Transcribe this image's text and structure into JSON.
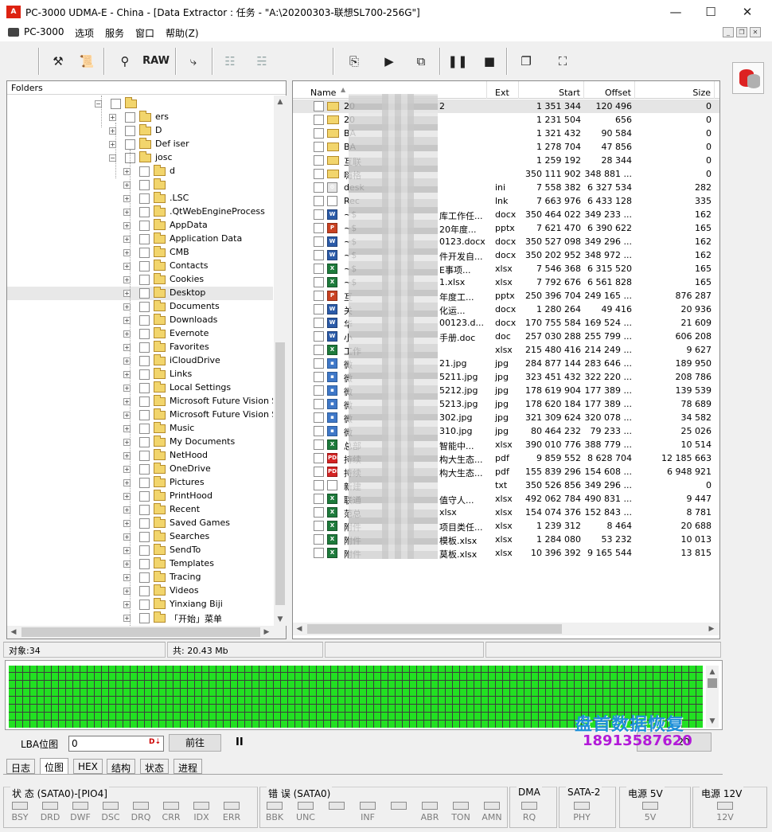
{
  "window": {
    "title": "PC-3000 UDMA-E - China - [Data Extractor : 任务 - \"A:\\20200303-联想SL700-256G\"]",
    "icon_text": "A",
    "minimize": "—",
    "maximize": "☐",
    "close": "✕"
  },
  "menu": [
    "PC-3000",
    "选项",
    "服务",
    "窗口",
    "帮助(Z)"
  ],
  "toolbar": {
    "raw_label": "RAW"
  },
  "folders_panel": {
    "header": "Folders",
    "items": [
      {
        "label": "",
        "level": 1,
        "expanded": true
      },
      {
        "label": "ers",
        "level": 2
      },
      {
        "label": "D",
        "level": 2
      },
      {
        "label": "Def  iser",
        "level": 2
      },
      {
        "label": "josc",
        "level": 2,
        "expanded": true
      },
      {
        "label": "d",
        "level": 3
      },
      {
        "label": "",
        "level": 3
      },
      {
        "label": ".LSC",
        "level": 3
      },
      {
        "label": ".QtWebEngineProcess",
        "level": 3
      },
      {
        "label": "AppData",
        "level": 3
      },
      {
        "label": "Application Data",
        "level": 3
      },
      {
        "label": "CMB",
        "level": 3
      },
      {
        "label": "Contacts",
        "level": 3
      },
      {
        "label": "Cookies",
        "level": 3
      },
      {
        "label": "Desktop",
        "level": 3,
        "selected": true
      },
      {
        "label": "Documents",
        "level": 3
      },
      {
        "label": "Downloads",
        "level": 3
      },
      {
        "label": "Evernote",
        "level": 3
      },
      {
        "label": "Favorites",
        "level": 3
      },
      {
        "label": "iCloudDrive",
        "level": 3
      },
      {
        "label": "Links",
        "level": 3
      },
      {
        "label": "Local Settings",
        "level": 3
      },
      {
        "label": "Microsoft  Future Vision Ser",
        "level": 3
      },
      {
        "label": "Microsoft  Future Vision Ser",
        "level": 3
      },
      {
        "label": "Music",
        "level": 3
      },
      {
        "label": "My Documents",
        "level": 3
      },
      {
        "label": "NetHood",
        "level": 3
      },
      {
        "label": "OneDrive",
        "level": 3
      },
      {
        "label": "Pictures",
        "level": 3
      },
      {
        "label": "PrintHood",
        "level": 3
      },
      {
        "label": "Recent",
        "level": 3
      },
      {
        "label": "Saved Games",
        "level": 3
      },
      {
        "label": "Searches",
        "level": 3
      },
      {
        "label": "SendTo",
        "level": 3
      },
      {
        "label": "Templates",
        "level": 3
      },
      {
        "label": "Tracing",
        "level": 3
      },
      {
        "label": "Videos",
        "level": 3
      },
      {
        "label": "Yinxiang Biji",
        "level": 3
      },
      {
        "label": "「开始」菜单",
        "level": 3
      }
    ]
  },
  "files_panel": {
    "columns": {
      "name": "Name",
      "ext": "Ext",
      "start": "Start",
      "offset": "Offset",
      "size": "Size"
    },
    "rows": [
      {
        "name": "20",
        "tail": "2",
        "ext": "",
        "start": "1 351 344",
        "offset": "120 496",
        "size": "0",
        "icon": "folder",
        "selected": true
      },
      {
        "name": "20",
        "tail": "",
        "ext": "",
        "start": "1 231 504",
        "offset": "656",
        "size": "0",
        "icon": "folder"
      },
      {
        "name": "BA",
        "tail": "",
        "ext": "",
        "start": "1 321 432",
        "offset": "90 584",
        "size": "0",
        "icon": "folder"
      },
      {
        "name": "BA",
        "tail": "",
        "ext": "",
        "start": "1 278 704",
        "offset": "47 856",
        "size": "0",
        "icon": "folder"
      },
      {
        "name": "互联",
        "tail": "",
        "ext": "",
        "start": "1 259 192",
        "offset": "28 344",
        "size": "0",
        "icon": "folder"
      },
      {
        "name": "嗨格",
        "tail": "",
        "ext": "",
        "start": "350 111 902",
        "offset": "348 881 ...",
        "size": "0",
        "icon": "folder"
      },
      {
        "name": "desk",
        "tail": "",
        "ext": "ini",
        "start": "7 558 382",
        "offset": "6 327 534",
        "size": "282",
        "icon": "ini"
      },
      {
        "name": "Rec",
        "tail": "",
        "ext": "lnk",
        "start": "7 663 976",
        "offset": "6 433 128",
        "size": "335",
        "icon": "lnk"
      },
      {
        "name": "~$",
        "tail": "库工作任...",
        "ext": "docx",
        "start": "350 464 022",
        "offset": "349 233 ...",
        "size": "162",
        "icon": "docx"
      },
      {
        "name": "~$",
        "tail": "20年度...",
        "ext": "pptx",
        "start": "7 621 470",
        "offset": "6 390 622",
        "size": "165",
        "icon": "pptx"
      },
      {
        "name": "~$",
        "tail": "0123.docx",
        "ext": "docx",
        "start": "350 527 098",
        "offset": "349 296 ...",
        "size": "162",
        "icon": "docx"
      },
      {
        "name": "~$",
        "tail": "件开发自...",
        "ext": "docx",
        "start": "350 202 952",
        "offset": "348 972 ...",
        "size": "162",
        "icon": "docx"
      },
      {
        "name": "~$",
        "tail": "E事项...",
        "ext": "xlsx",
        "start": "7 546 368",
        "offset": "6 315 520",
        "size": "165",
        "icon": "xlsx"
      },
      {
        "name": "~$",
        "tail": "1.xlsx",
        "ext": "xlsx",
        "start": "7 792 676",
        "offset": "6 561 828",
        "size": "165",
        "icon": "xlsx"
      },
      {
        "name": "互",
        "tail": "年度工...",
        "ext": "pptx",
        "start": "250 396 704",
        "offset": "249 165 ...",
        "size": "876 287",
        "icon": "pptx"
      },
      {
        "name": "关",
        "tail": "化运...",
        "ext": "docx",
        "start": "1 280 264",
        "offset": "49 416",
        "size": "20 936",
        "icon": "docx"
      },
      {
        "name": "华",
        "tail": "00123.d...",
        "ext": "docx",
        "start": "170 755 584",
        "offset": "169 524 ...",
        "size": "21 609",
        "icon": "docx"
      },
      {
        "name": "小",
        "tail": "手册.doc",
        "ext": "doc",
        "start": "257 030 288",
        "offset": "255 799 ...",
        "size": "606 208",
        "icon": "doc"
      },
      {
        "name": "工作",
        "tail": "",
        "ext": "xlsx",
        "start": "215 480 416",
        "offset": "214 249 ...",
        "size": "9 627",
        "icon": "xlsx"
      },
      {
        "name": "微",
        "tail": "21.jpg",
        "ext": "jpg",
        "start": "284 877 144",
        "offset": "283 646 ...",
        "size": "189 950",
        "icon": "jpg"
      },
      {
        "name": "微",
        "tail": "5211.jpg",
        "ext": "jpg",
        "start": "323 451 432",
        "offset": "322 220 ...",
        "size": "208 786",
        "icon": "jpg"
      },
      {
        "name": "微",
        "tail": "5212.jpg",
        "ext": "jpg",
        "start": "178 619 904",
        "offset": "177 389 ...",
        "size": "139 539",
        "icon": "jpg"
      },
      {
        "name": "微",
        "tail": "5213.jpg",
        "ext": "jpg",
        "start": "178 620 184",
        "offset": "177 389 ...",
        "size": "78 689",
        "icon": "jpg"
      },
      {
        "name": "微",
        "tail": "302.jpg",
        "ext": "jpg",
        "start": "321 309 624",
        "offset": "320 078 ...",
        "size": "34 582",
        "icon": "jpg"
      },
      {
        "name": "微",
        "tail": "310.jpg",
        "ext": "jpg",
        "start": "80 464 232",
        "offset": "79 233 ...",
        "size": "25 026",
        "icon": "jpg"
      },
      {
        "name": "总部",
        "tail": "智能中...",
        "ext": "xlsx",
        "start": "390 010 776",
        "offset": "388 779 ...",
        "size": "10 514",
        "icon": "xlsx"
      },
      {
        "name": "持续",
        "tail": "构大生态...",
        "ext": "pdf",
        "start": "9 859 552",
        "offset": "8 628 704",
        "size": "12 185 663",
        "icon": "pdf"
      },
      {
        "name": "持续",
        "tail": "构大生态...",
        "ext": "pdf",
        "start": "155 839 296",
        "offset": "154 608 ...",
        "size": "6 948 921",
        "icon": "pdf"
      },
      {
        "name": "新建",
        "tail": "",
        "ext": "txt",
        "start": "350 526 856",
        "offset": "349 296 ...",
        "size": "0",
        "icon": "txt"
      },
      {
        "name": "联通",
        "tail": "值守人...",
        "ext": "xlsx",
        "start": "492 062 784",
        "offset": "490 831 ...",
        "size": "9 447",
        "icon": "xlsx"
      },
      {
        "name": "范总",
        "tail": "xlsx",
        "ext": "xlsx",
        "start": "154 074 376",
        "offset": "152 843 ...",
        "size": "8 781",
        "icon": "xlsx"
      },
      {
        "name": "附件",
        "tail": "项目类任...",
        "ext": "xlsx",
        "start": "1 239 312",
        "offset": "8 464",
        "size": "20 688",
        "icon": "xlsx"
      },
      {
        "name": "附件",
        "tail": "模板.xlsx",
        "ext": "xlsx",
        "start": "1 284 080",
        "offset": "53 232",
        "size": "10 013",
        "icon": "xlsx"
      },
      {
        "name": "附件",
        "tail": "莫板.xlsx",
        "ext": "xlsx",
        "start": "10 396 392",
        "offset": "9 165 544",
        "size": "13 815",
        "icon": "xlsx"
      }
    ]
  },
  "status": {
    "objects": "对象:34",
    "total": "共: 20.43 Mb"
  },
  "lba": {
    "label": "LBA位图",
    "value": "0",
    "go_button": "前往",
    "pause": "II",
    "button2": "20"
  },
  "watermark": {
    "line1": "盘首数据恢复",
    "line2": "18913587620"
  },
  "tabs": [
    "日志",
    "位图",
    "HEX",
    "结构",
    "状态",
    "进程"
  ],
  "active_tab": 1,
  "indicators": {
    "status_group": {
      "title": "状 态 (SATA0)-[PIO4]",
      "leds": [
        "BSY",
        "DRD",
        "DWF",
        "DSC",
        "DRQ",
        "CRR",
        "IDX",
        "ERR"
      ]
    },
    "error_group": {
      "title": "错 误 (SATA0)",
      "leds": [
        "BBK",
        "UNC",
        "",
        "INF",
        "",
        "ABR",
        "TON",
        "AMN"
      ]
    },
    "dma_group": {
      "title": "DMA",
      "leds": [
        "RQ"
      ]
    },
    "sata_group": {
      "title": "SATA-2",
      "leds": [
        "PHY"
      ]
    },
    "p5_group": {
      "title": "电源 5V",
      "leds": [
        "5V"
      ]
    },
    "p12_group": {
      "title": "电源 12V",
      "leds": [
        "12V"
      ]
    }
  }
}
